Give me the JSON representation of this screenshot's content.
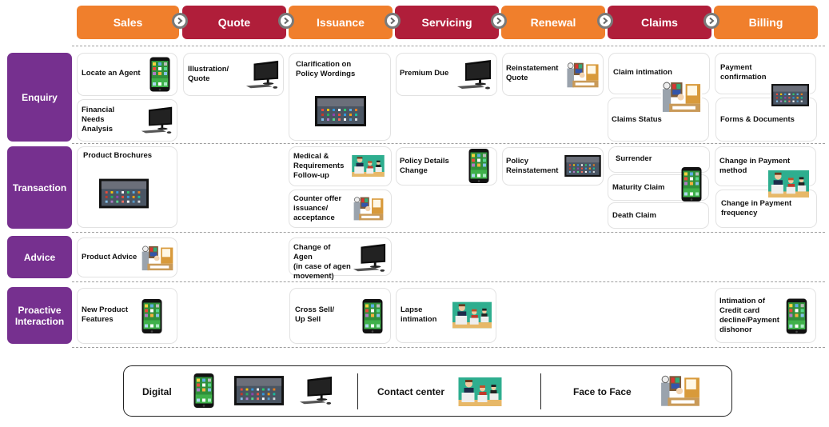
{
  "stages": [
    {
      "label": "Sales",
      "color": "#f07f2c"
    },
    {
      "label": "Quote",
      "color": "#b01e3a"
    },
    {
      "label": "Issuance",
      "color": "#f07f2c"
    },
    {
      "label": "Servicing",
      "color": "#b01e3a"
    },
    {
      "label": "Renewal",
      "color": "#f07f2c"
    },
    {
      "label": "Claims",
      "color": "#b01e3a"
    },
    {
      "label": "Billing",
      "color": "#f07f2c"
    }
  ],
  "stage_connector_icon": "chevron-right-circle-icon",
  "categories": [
    {
      "label": "Enquiry"
    },
    {
      "label": "Transaction"
    },
    {
      "label": "Advice"
    },
    {
      "label": "Proactive\nInteraction"
    }
  ],
  "colors": {
    "category": "#76308f",
    "stage_orange": "#f07f2c",
    "stage_red": "#b01e3a"
  },
  "cards": {
    "locate_agent": {
      "label": "Locate an Agent",
      "channel": "mobile"
    },
    "financial_needs": {
      "label": "Financial\nNeeds\nAnalysis",
      "channel": "desktop"
    },
    "illustration_quote": {
      "label": "Illustration/\nQuote",
      "channel": "desktop"
    },
    "clarification": {
      "label": "Clarification on\nPolicy Wordings",
      "channel": "tablet"
    },
    "premium_due": {
      "label": "Premium Due",
      "channel": "desktop"
    },
    "reinstatement_quote": {
      "label": "Reinstatement\nQuote",
      "channel": "face-to-face"
    },
    "claim_intimation": {
      "label": "Claim intimation",
      "channel": "face-to-face"
    },
    "claims_status": {
      "label": "Claims Status",
      "channel": "face-to-face"
    },
    "payment_confirmation": {
      "label": "Payment\nconfirmation",
      "channel": "tablet"
    },
    "forms_documents": {
      "label": "Forms & Documents",
      "channel": "tablet"
    },
    "product_brochures": {
      "label": "Product Brochures",
      "channel": "tablet"
    },
    "medical_followup": {
      "label": "Medical &\nRequirements\nFollow-up",
      "channel": "contact-center"
    },
    "counter_offer": {
      "label": "Counter offer\nissuance/\nacceptance",
      "channel": "face-to-face"
    },
    "policy_details_change": {
      "label": "Policy Details\nChange",
      "channel": "mobile"
    },
    "policy_reinstatement": {
      "label": "Policy\nReinstatement",
      "channel": "tablet"
    },
    "surrender": {
      "label": "Surrender",
      "channel": "mobile"
    },
    "maturity_claim": {
      "label": "Maturity Claim",
      "channel": "mobile"
    },
    "death_claim": {
      "label": "Death Claim",
      "channel": "mobile"
    },
    "change_payment_method": {
      "label": "Change in Payment\nmethod",
      "channel": "contact-center"
    },
    "change_payment_frequency": {
      "label": "Change in Payment\nfrequency",
      "channel": "contact-center"
    },
    "product_advice": {
      "label": "Product Advice",
      "channel": "face-to-face"
    },
    "change_of_agent": {
      "label": "Change of Agen\n(in case of agen\nmovement)",
      "channel": "desktop"
    },
    "new_product_features": {
      "label": "New Product\nFeatures",
      "channel": "mobile"
    },
    "cross_sell": {
      "label": "Cross Sell/\nUp Sell",
      "channel": "mobile"
    },
    "lapse_intimation": {
      "label": "Lapse\n intimation",
      "channel": "contact-center"
    },
    "credit_card_decline": {
      "label": "Intimation of\nCredit card\ndecline/Payment\ndishonor",
      "channel": "mobile"
    }
  },
  "legend": {
    "digital": {
      "label": "Digital",
      "icons": [
        "mobile-phone-icon",
        "tablet-icon",
        "desktop-computer-icon"
      ]
    },
    "contact_center": {
      "label": "Contact center",
      "icons": [
        "contact-center-agents-icon"
      ]
    },
    "face_to_face": {
      "label": "Face to Face",
      "icons": [
        "office-desk-icon"
      ]
    }
  }
}
